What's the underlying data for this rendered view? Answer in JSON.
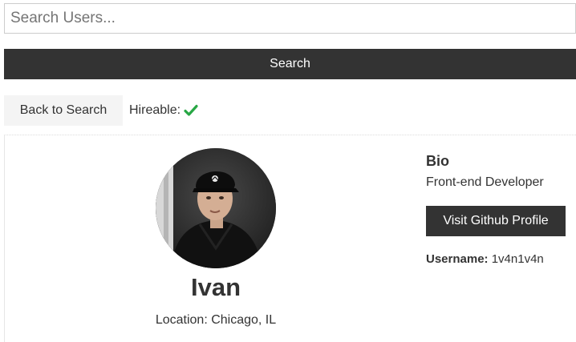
{
  "search": {
    "placeholder": "Search Users...",
    "value": "",
    "button_label": "Search"
  },
  "controls": {
    "back_label": "Back to Search",
    "hireable_label": "Hireable:",
    "hireable": true,
    "hireable_icon": "check-icon",
    "check_color": "#28a745"
  },
  "profile": {
    "avatar_icon": "avatar",
    "name": "Ivan",
    "location": "Location: Chicago, IL",
    "bio_heading": "Bio",
    "bio": "Front-end Developer",
    "github_button_label": "Visit Github Profile",
    "username_label": "Username:",
    "username": "1v4n1v4n"
  },
  "colors": {
    "dark_button": "#333333",
    "light_button": "#f4f4f4",
    "text": "#333333"
  }
}
